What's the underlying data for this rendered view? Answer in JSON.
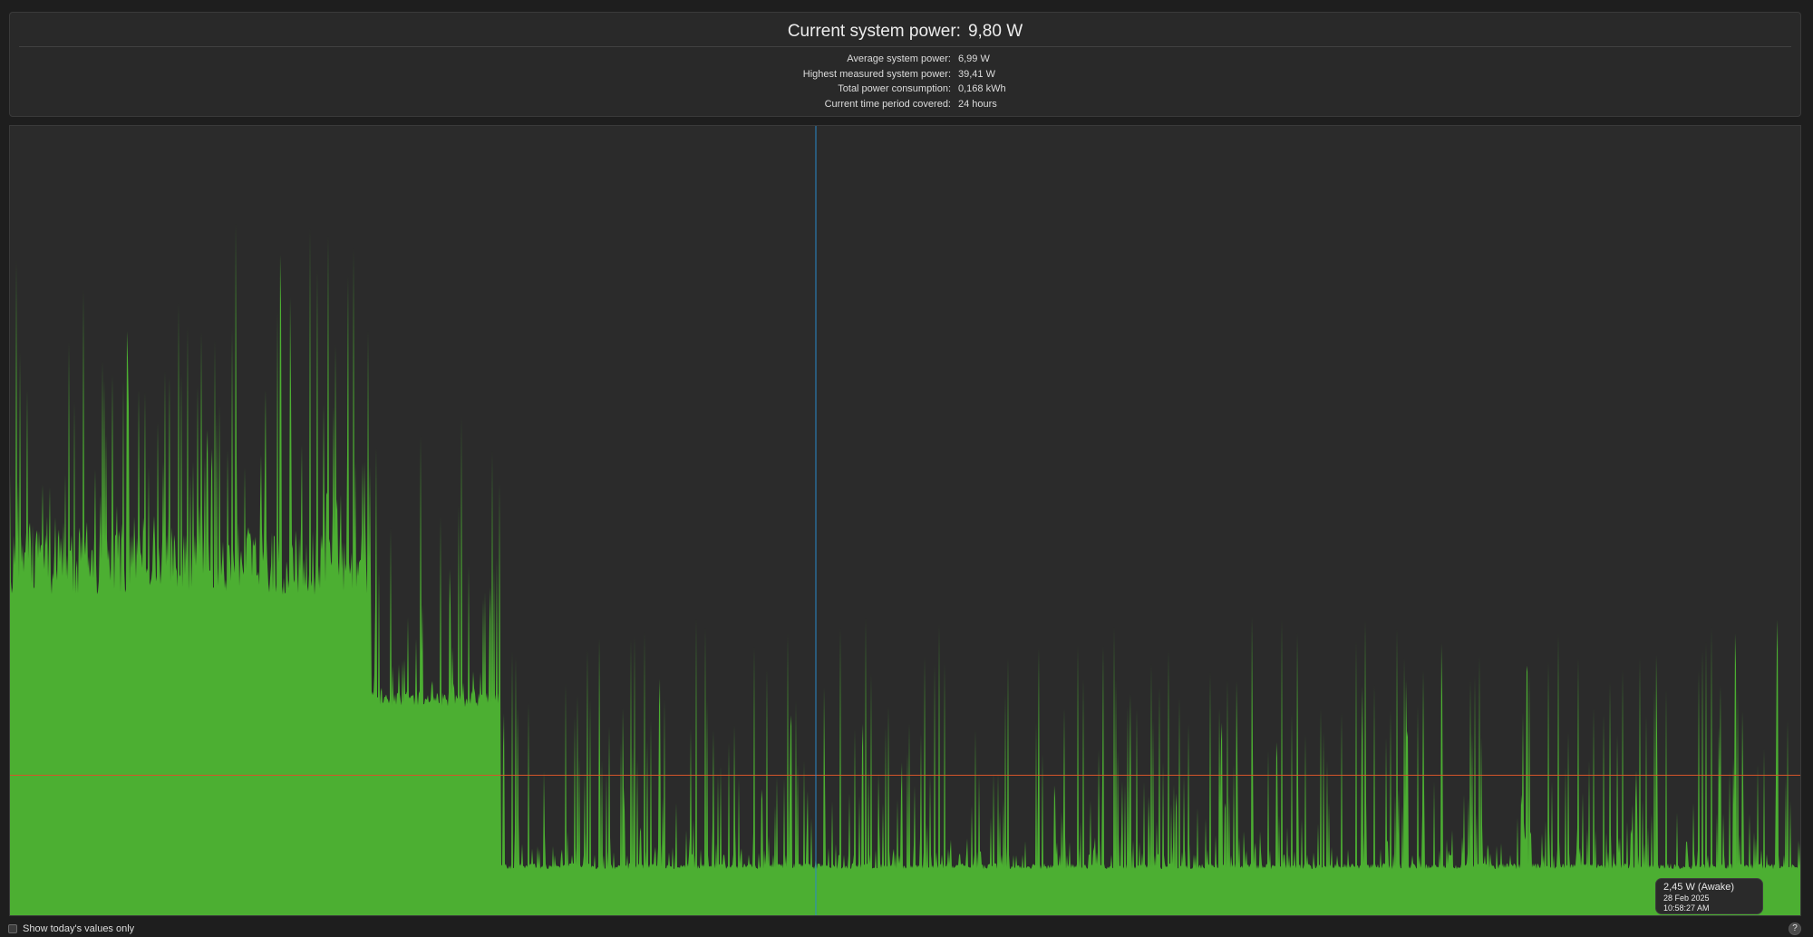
{
  "header": {
    "current_label": "Current system power:",
    "current_value": "9,80 W"
  },
  "stats": [
    {
      "label": "Average system power:",
      "value": "6,99 W"
    },
    {
      "label": "Highest measured system power:",
      "value": "39,41 W"
    },
    {
      "label": "Total power consumption:",
      "value": "0,168 kWh"
    },
    {
      "label": "Current time period covered:",
      "value": "24 hours"
    }
  ],
  "tooltip": {
    "value": "2,45 W (Awake)",
    "date": "28 Feb 2025",
    "time": "10:58:27 AM"
  },
  "footer": {
    "checkbox_label": "Show today's values only",
    "help_symbol": "?"
  },
  "colors": {
    "fill": "#4caf32",
    "cursor_line": "#2a88c9",
    "average_line": "#d4552a",
    "background": "#2b2b2b"
  },
  "chart_data": {
    "type": "area",
    "period": "24 hours",
    "y_unit": "W",
    "ylim": [
      0,
      39.41
    ],
    "average_line": 6.99,
    "cursor_fraction": 0.45,
    "segments": [
      {
        "from": 0.0,
        "to": 0.202,
        "base": 17.5,
        "spike_low": 19,
        "spike_high": 35,
        "noise": 3.0
      },
      {
        "from": 0.202,
        "to": 0.274,
        "base": 10.8,
        "spike_low": 11,
        "spike_high": 25,
        "noise": 0.8
      },
      {
        "from": 0.274,
        "to": 1.0,
        "base": 2.45,
        "spike_low": 3,
        "spike_high": 15,
        "noise": 0.3
      }
    ]
  }
}
